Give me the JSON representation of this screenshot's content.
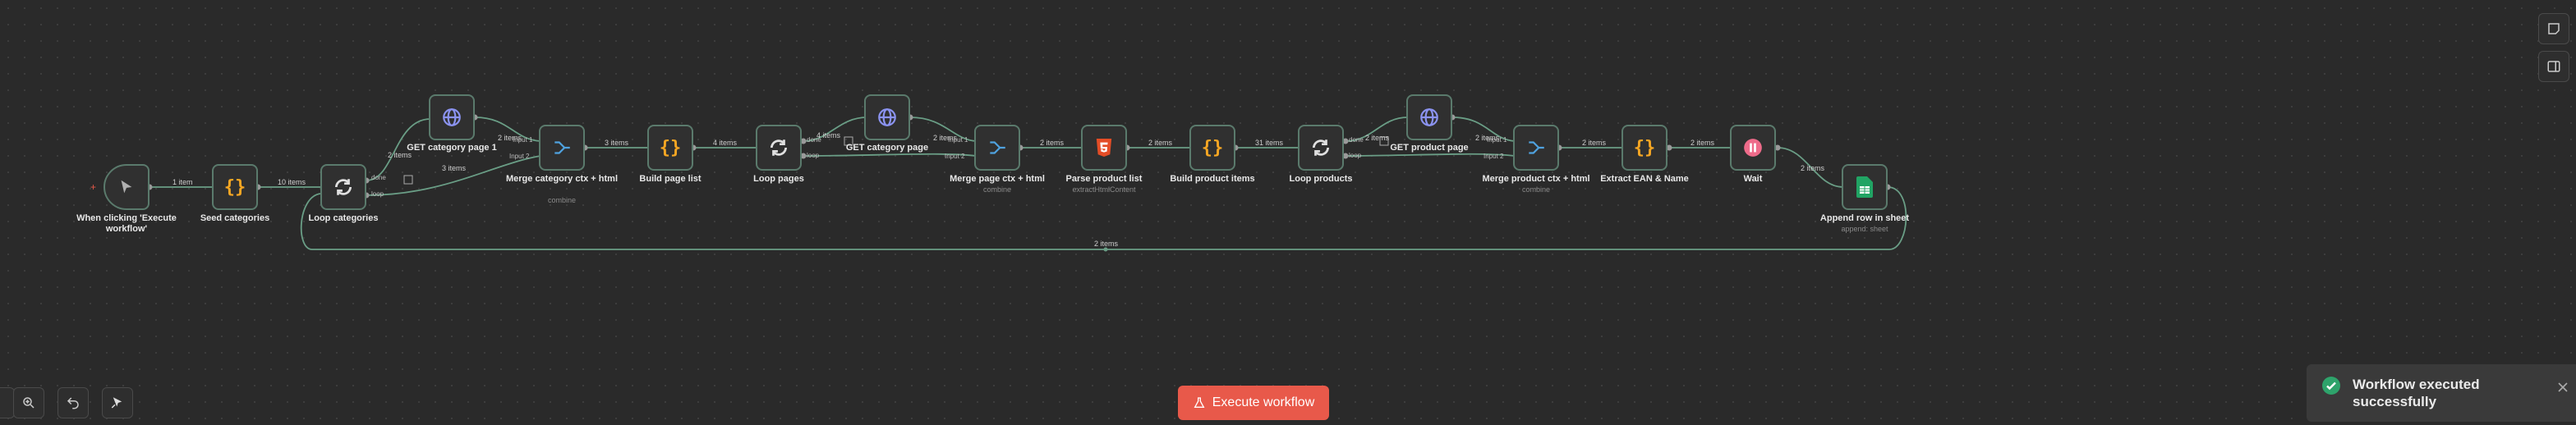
{
  "workflow": {
    "nodes": [
      {
        "id": "trigger",
        "label": "When clicking 'Execute workflow'",
        "sub": "",
        "icon": "cursor-icon",
        "color": "#b0b0b0"
      },
      {
        "id": "seed",
        "label": "Seed categories",
        "sub": "",
        "icon": "code-braces-icon",
        "color": "#f5a623"
      },
      {
        "id": "loopcat",
        "label": "Loop categories",
        "sub": "",
        "icon": "loop-icon",
        "color": "#e0e0e0"
      },
      {
        "id": "getcat",
        "label": "GET category page 1",
        "sub": "",
        "icon": "globe-icon",
        "color": "#8b93f0"
      },
      {
        "id": "mergecat",
        "label": "Merge category ctx + html",
        "sub": "combine",
        "icon": "merge-icon",
        "color": "#4fa3e0"
      },
      {
        "id": "buildpage",
        "label": "Build page list",
        "sub": "",
        "icon": "code-braces-icon",
        "color": "#f5a623"
      },
      {
        "id": "looppages",
        "label": "Loop pages",
        "sub": "",
        "icon": "loop-icon",
        "color": "#e0e0e0"
      },
      {
        "id": "getcatpage",
        "label": "GET category page",
        "sub": "",
        "icon": "globe-icon",
        "color": "#8b93f0"
      },
      {
        "id": "mergepage",
        "label": "Merge page ctx + html",
        "sub": "combine",
        "icon": "merge-icon",
        "color": "#4fa3e0"
      },
      {
        "id": "parse",
        "label": "Parse product list",
        "sub": "extractHtmlContent",
        "icon": "html5-icon",
        "color": "#e44d26"
      },
      {
        "id": "buildprod",
        "label": "Build product items",
        "sub": "",
        "icon": "code-braces-icon",
        "color": "#f5a623"
      },
      {
        "id": "loopprod",
        "label": "Loop products",
        "sub": "",
        "icon": "loop-icon",
        "color": "#e0e0e0"
      },
      {
        "id": "getprod",
        "label": "GET product page",
        "sub": "",
        "icon": "globe-icon",
        "color": "#8b93f0"
      },
      {
        "id": "mergeprod",
        "label": "Merge product ctx + html",
        "sub": "combine",
        "icon": "merge-icon",
        "color": "#4fa3e0"
      },
      {
        "id": "extract",
        "label": "Extract EAN & Name",
        "sub": "",
        "icon": "code-braces-icon",
        "color": "#f5a623"
      },
      {
        "id": "wait",
        "label": "Wait",
        "sub": "",
        "icon": "pause-icon",
        "color": "#ee6b8a"
      },
      {
        "id": "append",
        "label": "Append row in sheet",
        "sub": "append: sheet",
        "icon": "sheets-icon",
        "color": "#21a464"
      }
    ],
    "edge_labels": {
      "e1": "1 item",
      "e2": "10 items",
      "e3": "2 items",
      "e4": "3 items",
      "e5": "2 items",
      "e6": "3 items",
      "e7": "4 items",
      "e8": "4 items",
      "e9": "2 items",
      "e10": "2 items",
      "e11": "2 items",
      "e12": "31 items",
      "e13": "2 items",
      "e14": "2 items",
      "e15": "2 items",
      "e16": "2 items",
      "e17": "2 items",
      "e18": "2 items"
    },
    "port_labels": {
      "done": "done",
      "loop": "loop",
      "input1": "Input 1",
      "input2": "Input 2"
    }
  },
  "toolbar": {
    "zoom_in": "zoom-in-icon",
    "undo": "undo-icon",
    "select": "pointer-icon"
  },
  "execute_button": {
    "label": "Execute workflow",
    "icon": "flask-icon"
  },
  "toast": {
    "message": "Workflow executed successfully",
    "status_color": "#2ea36b"
  },
  "colors": {
    "accent": "#e8594a",
    "edge": "#5a9a7e",
    "canvas": "#2a2a2a"
  }
}
